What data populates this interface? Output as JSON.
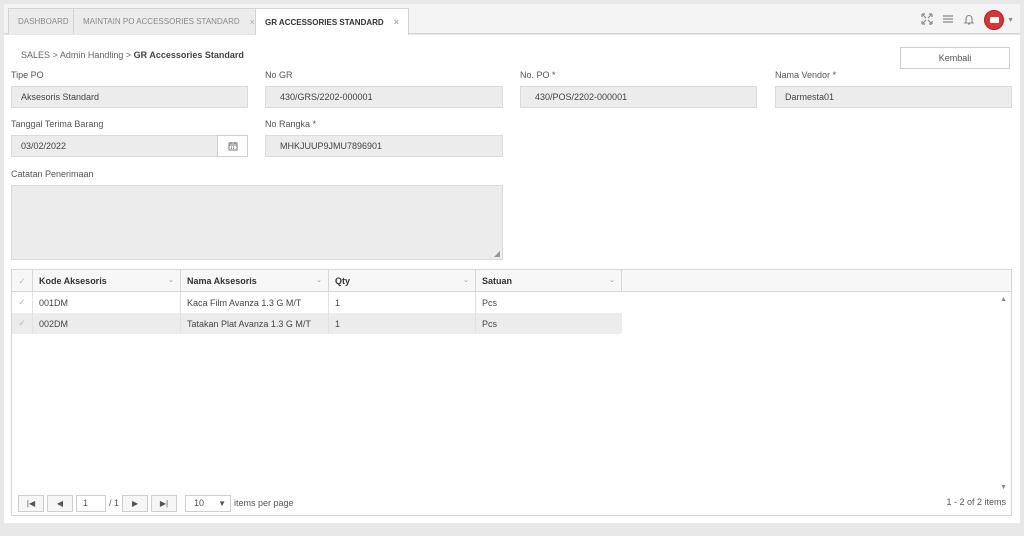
{
  "tabs": [
    {
      "label": "DASHBOARD"
    },
    {
      "label": "MAINTAIN PO ACCESSORIES STANDARD",
      "close": "×"
    },
    {
      "label": "GR ACCESSORIES STANDARD",
      "close": "×"
    }
  ],
  "header_icons": [
    "expand-icon",
    "menu-icon",
    "bell-icon",
    "avatar",
    "chevron-down-icon"
  ],
  "breadcrumb": {
    "part1": "SALES",
    "sep": ">",
    "part2": "Admin Handling",
    "current": "GR Accessories Standard"
  },
  "back_button": "Kembali",
  "form": {
    "tipe_po": {
      "label": "Tipe PO",
      "value": "Aksesoris Standard"
    },
    "no_gr": {
      "label": "No GR",
      "value": "430/GRS/2202-000001"
    },
    "no_po": {
      "label": "No. PO *",
      "value": "430/POS/2202-000001"
    },
    "nama_vendor": {
      "label": "Nama Vendor *",
      "value": "Darmesta01"
    },
    "tanggal": {
      "label": "Tanggal Terima Barang",
      "value": "03/02/2022"
    },
    "no_rangka": {
      "label": "No Rangka *",
      "value": "MHKJUUP9JMU7896901"
    },
    "catatan": {
      "label": "Catatan Penerimaan",
      "value": ""
    }
  },
  "grid": {
    "columns": [
      "Kode Aksesoris",
      "Nama Aksesoris",
      "Qty",
      "Satuan"
    ],
    "rows": [
      {
        "kode": "001DM",
        "nama": "Kaca Film Avanza 1.3 G M/T",
        "qty": "1",
        "satuan": "Pcs"
      },
      {
        "kode": "002DM",
        "nama": "Tatakan Plat Avanza 1.3 G M/T",
        "qty": "1",
        "satuan": "Pcs"
      }
    ]
  },
  "pager": {
    "page": "1",
    "of": "/ 1",
    "page_size": "10",
    "items_per_page": "items per page",
    "info": "1 - 2 of 2 items"
  }
}
